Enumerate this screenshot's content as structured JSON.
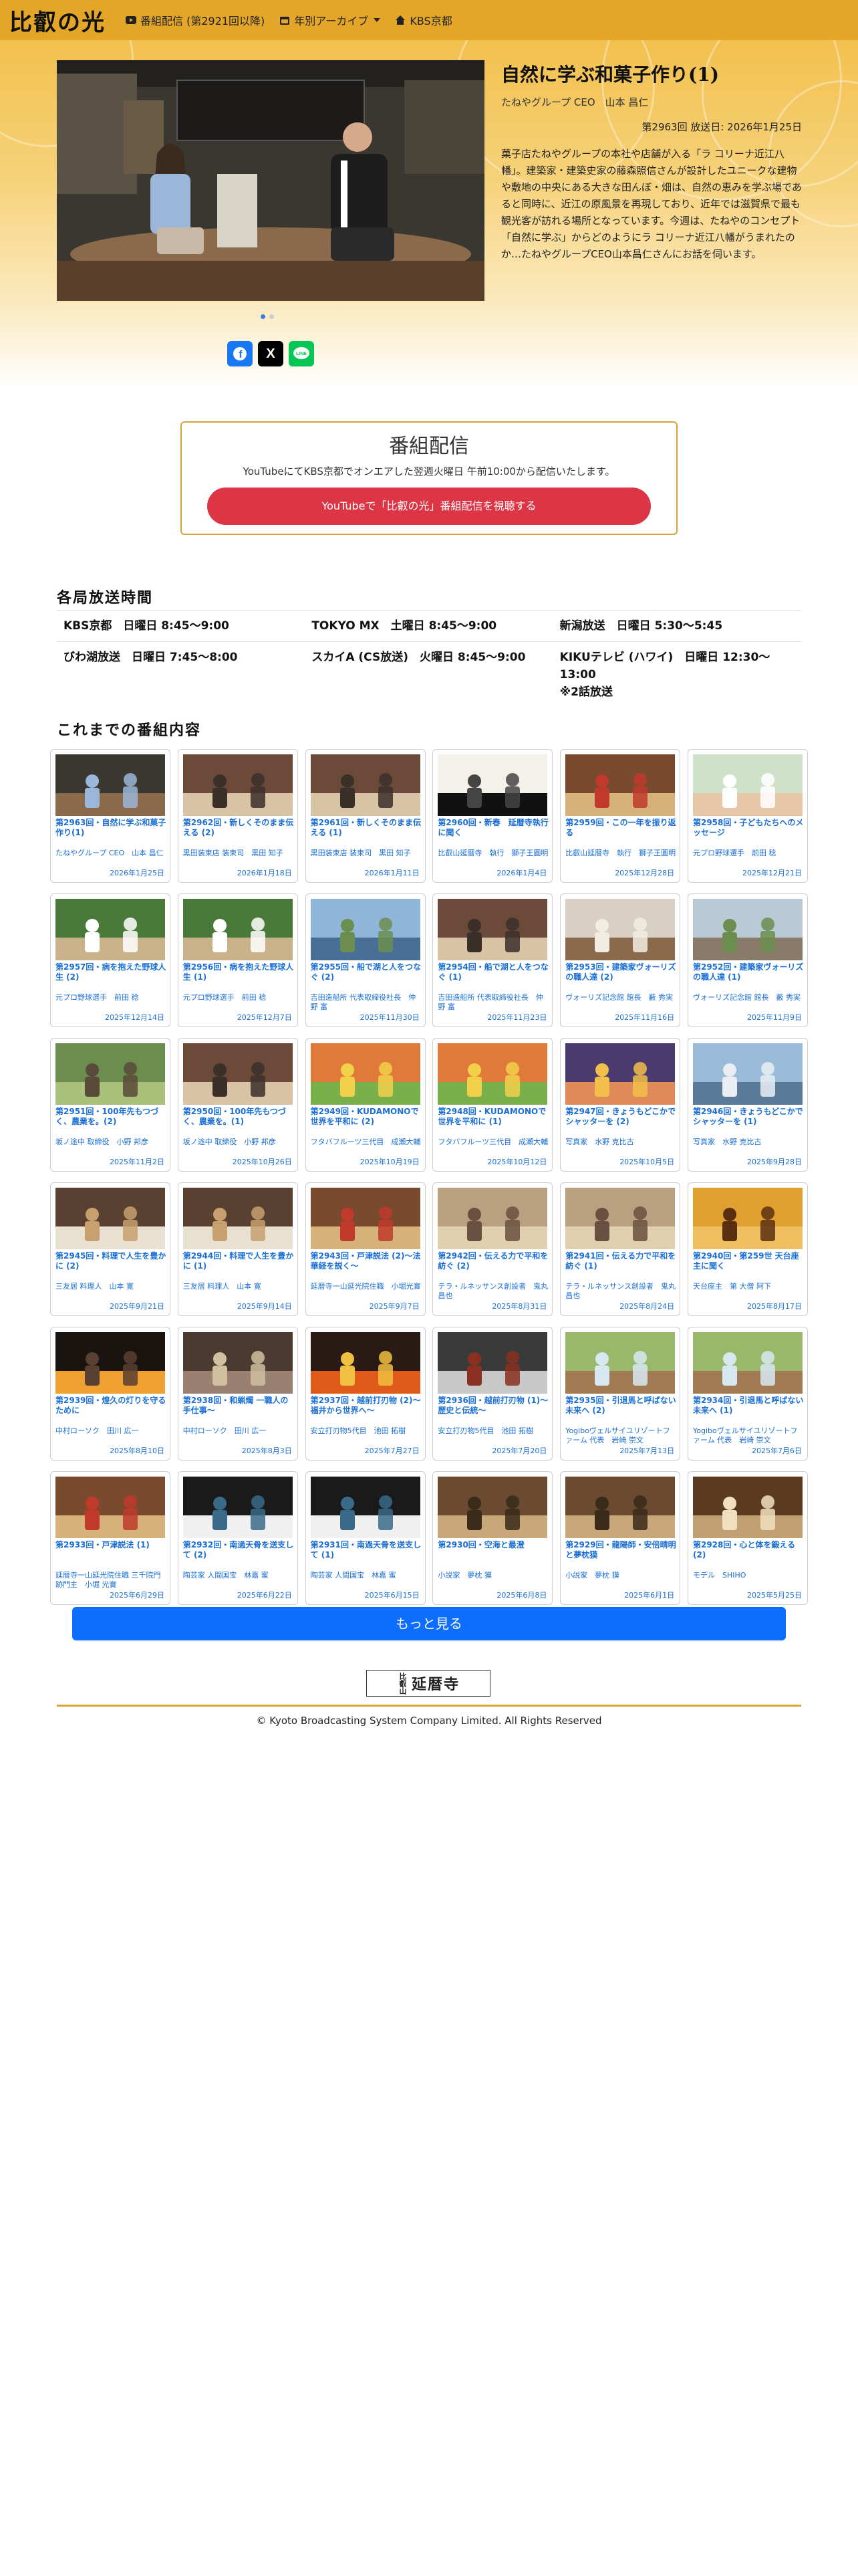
{
  "nav": {
    "brand": "比叡の光",
    "items": [
      {
        "label": "番組配信 (第2921回以降)",
        "icon": "youtube-icon"
      },
      {
        "label": "年別アーカイブ",
        "icon": "calendar-icon",
        "dropdown": true
      },
      {
        "label": "KBS京都",
        "icon": "home-icon"
      }
    ]
  },
  "hero": {
    "title": "自然に学ぶ和菓子作り(1)",
    "guest": "たねやグループ CEO　山本 昌仁",
    "episode_date": "第2963回 放送日: 2026年1月25日",
    "description": "菓子店たねやグループの本社や店舗が入る「ラ コリーナ近江八幡」。建築家・建築史家の藤森照信さんが設計したユニークな建物や敷地の中央にある大きな田んぼ・畑は、自然の恵みを学ぶ場であると同時に、近江の原風景を再現しており、近年では滋賀県で最も観光客が訪れる場所となっています。今週は、たねやのコンセプト「自然に学ぶ」からどのようにラ コリーナ近江八幡がうまれたのか…たねやグループCEO山本昌仁さんにお話を伺います。",
    "share": [
      "f",
      "X",
      "LINE"
    ]
  },
  "broadcast": {
    "title": "番組配信",
    "text": "YouTubeにてKBS京都でオンエアした翌週火曜日 午前10:00から配信いたします。",
    "button": "YouTubeで「比叡の光」番組配信を視聴する"
  },
  "schedule": {
    "title": "各局放送時間",
    "rows": [
      [
        "KBS京都　日曜日 8:45〜9:00",
        "TOKYO MX　土曜日 8:45〜9:00",
        "新潟放送　日曜日 5:30〜5:45"
      ],
      [
        "びわ湖放送　日曜日 7:45〜8:00",
        "スカイA (CS放送)　火曜日 8:45〜9:00",
        "KIKUテレビ (ハワイ)　日曜日 12:30〜13:00\n※2話放送"
      ]
    ]
  },
  "episodes_title": "これまでの番組内容",
  "episodes": [
    {
      "title": "第2963回・自然に学ぶ和菓子作り(1)",
      "guest": "たねやグループ CEO　山本 昌仁",
      "date": "2026年1月25日",
      "thumb": "studio-icon"
    },
    {
      "title": "第2962回・新しくそのまま伝える (2)",
      "guest": "黒田装束店 装束司　黒田 知子",
      "date": "2026年1月18日",
      "thumb": "interview-icon"
    },
    {
      "title": "第2961回・新しくそのまま伝える (1)",
      "guest": "黒田装束店 装束司　黒田 知子",
      "date": "2026年1月11日",
      "thumb": "interview-icon"
    },
    {
      "title": "第2960回・新春　延暦寺執行に聞く",
      "guest": "比叡山延暦寺　執行　獅子王圓明",
      "date": "2026年1月4日",
      "thumb": "calligraphy-icon"
    },
    {
      "title": "第2959回・この一年を振り返る",
      "guest": "比叡山延暦寺　執行　獅子王圓明",
      "date": "2025年12月28日",
      "thumb": "temple-icon"
    },
    {
      "title": "第2958回・子どもたちへのメッセージ",
      "guest": "元プロ野球選手　前田 稔",
      "date": "2025年12月21日",
      "thumb": "portrait-icon"
    },
    {
      "title": "第2957回・病を抱えた野球人生 (2)",
      "guest": "元プロ野球選手　前田 稔",
      "date": "2025年12月14日",
      "thumb": "baseball-icon"
    },
    {
      "title": "第2956回・病を抱えた野球人生 (1)",
      "guest": "元プロ野球選手　前田 稔",
      "date": "2025年12月7日",
      "thumb": "baseball-icon"
    },
    {
      "title": "第2955回・船で湖と人をつなぐ (2)",
      "guest": "吉田造船所 代表取締役社長　仲野 富",
      "date": "2025年11月30日",
      "thumb": "lake-icon"
    },
    {
      "title": "第2954回・船で湖と人をつなぐ (1)",
      "guest": "吉田造船所 代表取締役社長　仲野 富",
      "date": "2025年11月23日",
      "thumb": "interview-icon"
    },
    {
      "title": "第2953回・建築家ヴォーリズの職人達 (2)",
      "guest": "ヴォーリズ記念館 館長　藪 秀実",
      "date": "2025年11月16日",
      "thumb": "room-icon"
    },
    {
      "title": "第2952回・建築家ヴォーリズの職人達 (1)",
      "guest": "ヴォーリズ記念館 館長　藪 秀実",
      "date": "2025年11月9日",
      "thumb": "building-icon"
    },
    {
      "title": "第2951回・100年先もつづく、農業を。(2)",
      "guest": "坂ノ途中 取締役　小野 邦彦",
      "date": "2025年11月2日",
      "thumb": "farm-icon"
    },
    {
      "title": "第2950回・100年先もつづく、農業を。(1)",
      "guest": "坂ノ途中 取締役　小野 邦彦",
      "date": "2025年10月26日",
      "thumb": "interview-icon"
    },
    {
      "title": "第2949回・KUDAMONOで世界を平和に (2)",
      "guest": "フタバフルーツ三代目　成瀬大輔",
      "date": "2025年10月19日",
      "thumb": "fruit-icon"
    },
    {
      "title": "第2948回・KUDAMONOで世界を平和に (1)",
      "guest": "フタバフルーツ三代目　成瀬大輔",
      "date": "2025年10月12日",
      "thumb": "fruit-icon"
    },
    {
      "title": "第2947回・きょうもどこかでシャッターを (2)",
      "guest": "写真家　水野 克比古",
      "date": "2025年10月5日",
      "thumb": "sunset-icon"
    },
    {
      "title": "第2946回・きょうもどこかでシャッターを (1)",
      "guest": "写真家　水野 克比古",
      "date": "2025年9月28日",
      "thumb": "landscape-icon"
    },
    {
      "title": "第2945回・料理で人生を豊かに (2)",
      "guest": "三友居 料理人　山本 寛",
      "date": "2025年9月21日",
      "thumb": "kitchen-icon"
    },
    {
      "title": "第2944回・料理で人生を豊かに (1)",
      "guest": "三友居 料理人　山本 寛",
      "date": "2025年9月14日",
      "thumb": "kitchen-icon"
    },
    {
      "title": "第2943回・戸津説法 (2)〜法華経を説く〜",
      "guest": "延暦寺一山延光院住職　小堀光實",
      "date": "2025年9月7日",
      "thumb": "temple-icon"
    },
    {
      "title": "第2942回・伝える力で平和を紡ぐ (2)",
      "guest": "テラ・ルネッサンス創設者　鬼丸 昌也",
      "date": "2025年8月31日",
      "thumb": "crowd-icon"
    },
    {
      "title": "第2941回・伝える力で平和を紡ぐ (1)",
      "guest": "テラ・ルネッサンス創設者　鬼丸 昌也",
      "date": "2025年8月24日",
      "thumb": "crowd-icon"
    },
    {
      "title": "第2940回・第259世 天台座主に聞く",
      "guest": "天台座主　第 大僧 阿下",
      "date": "2025年8月17日",
      "thumb": "monk-icon"
    },
    {
      "title": "第2939回・煌久の灯りを守るために",
      "guest": "中村ローソク　田川 広一",
      "date": "2025年8月10日",
      "thumb": "candle-icon"
    },
    {
      "title": "第2938回・和蝋燭 一職人の手仕事〜",
      "guest": "中村ローソク　田川 広一",
      "date": "2025年8月3日",
      "thumb": "workshop-icon"
    },
    {
      "title": "第2937回・越前打刃物 (2)〜福井から世界へ〜",
      "guest": "安立打刃物5代目　池田 拓樹",
      "date": "2025年7月27日",
      "thumb": "forge-icon"
    },
    {
      "title": "第2936回・越前打刃物 (1)〜歴史と伝統〜",
      "guest": "安立打刃物5代目　池田 拓樹",
      "date": "2025年7月20日",
      "thumb": "knife-icon"
    },
    {
      "title": "第2935回・引退馬と呼ばない未来へ (2)",
      "guest": "Yogiboヴェルサイユリゾートファーム 代表　岩崎 崇文",
      "date": "2025年7月13日",
      "thumb": "horse-icon"
    },
    {
      "title": "第2934回・引退馬と呼ばない未来へ (1)",
      "guest": "Yogiboヴェルサイユリゾートファーム 代表　岩崎 崇文",
      "date": "2025年7月6日",
      "thumb": "horse-icon"
    },
    {
      "title": "第2933回・戸津説法 (1)",
      "guest": "延暦寺一山延光院住職 三千院門跡門主　小堀 光實",
      "date": "2025年6月29日",
      "thumb": "temple-icon"
    },
    {
      "title": "第2932回・南過天骨を送支して (2)",
      "guest": "陶芸家 人間国宝　林嘉 蜜",
      "date": "2025年6月22日",
      "thumb": "ceramic-icon"
    },
    {
      "title": "第2931回・南過天骨を送支して (1)",
      "guest": "陶芸家 人間国宝　林嘉 蜜",
      "date": "2025年6月15日",
      "thumb": "ceramic-icon"
    },
    {
      "title": "第2930回・空海と最澄",
      "guest": "小説家　夢枕 獏",
      "date": "2025年6月8日",
      "thumb": "library-icon"
    },
    {
      "title": "第2929回・龍陽師・安倍晴明と夢枕獏",
      "guest": "小説家　夢枕 獏",
      "date": "2025年6月1日",
      "thumb": "library-icon"
    },
    {
      "title": "第2928回・心と体を鍛える(2)",
      "guest": "モデル　SHIHO",
      "date": "2025年5月25日",
      "thumb": "dojo-icon"
    }
  ],
  "more_button": "もっと見る",
  "footer_logo": {
    "small": "比叡山",
    "main": "延暦寺"
  },
  "footer": "© Kyoto Broadcasting System Company Limited. All Rights Reserved"
}
